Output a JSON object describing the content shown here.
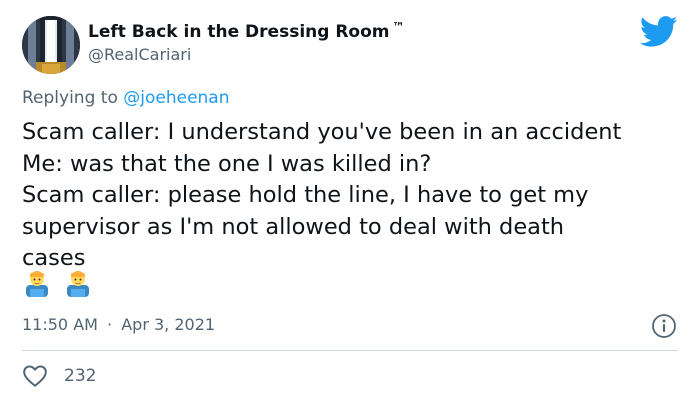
{
  "author": {
    "display_name": "Left Back in the Dressing Room",
    "trademark": "™",
    "handle": "@RealCariari"
  },
  "reply": {
    "prefix": "Replying to",
    "mention": "@joeheenan"
  },
  "tweet": {
    "lines": [
      "Scam caller: I understand you've been in an accident",
      "Me: was that the one I was killed in?",
      "Scam caller: please hold the line, I have to get my",
      "supervisor as I'm not allowed to deal with death",
      "cases"
    ],
    "emojis": [
      "man-technologist-emoji",
      "man-technologist-emoji"
    ]
  },
  "meta": {
    "time": "11:50 AM",
    "separator": "·",
    "date": "Apr 3, 2021"
  },
  "engagement": {
    "likes": "232"
  },
  "colors": {
    "brand_blue": "#1d9bf0",
    "secondary_text": "#536471",
    "divider": "#cfd9de"
  }
}
